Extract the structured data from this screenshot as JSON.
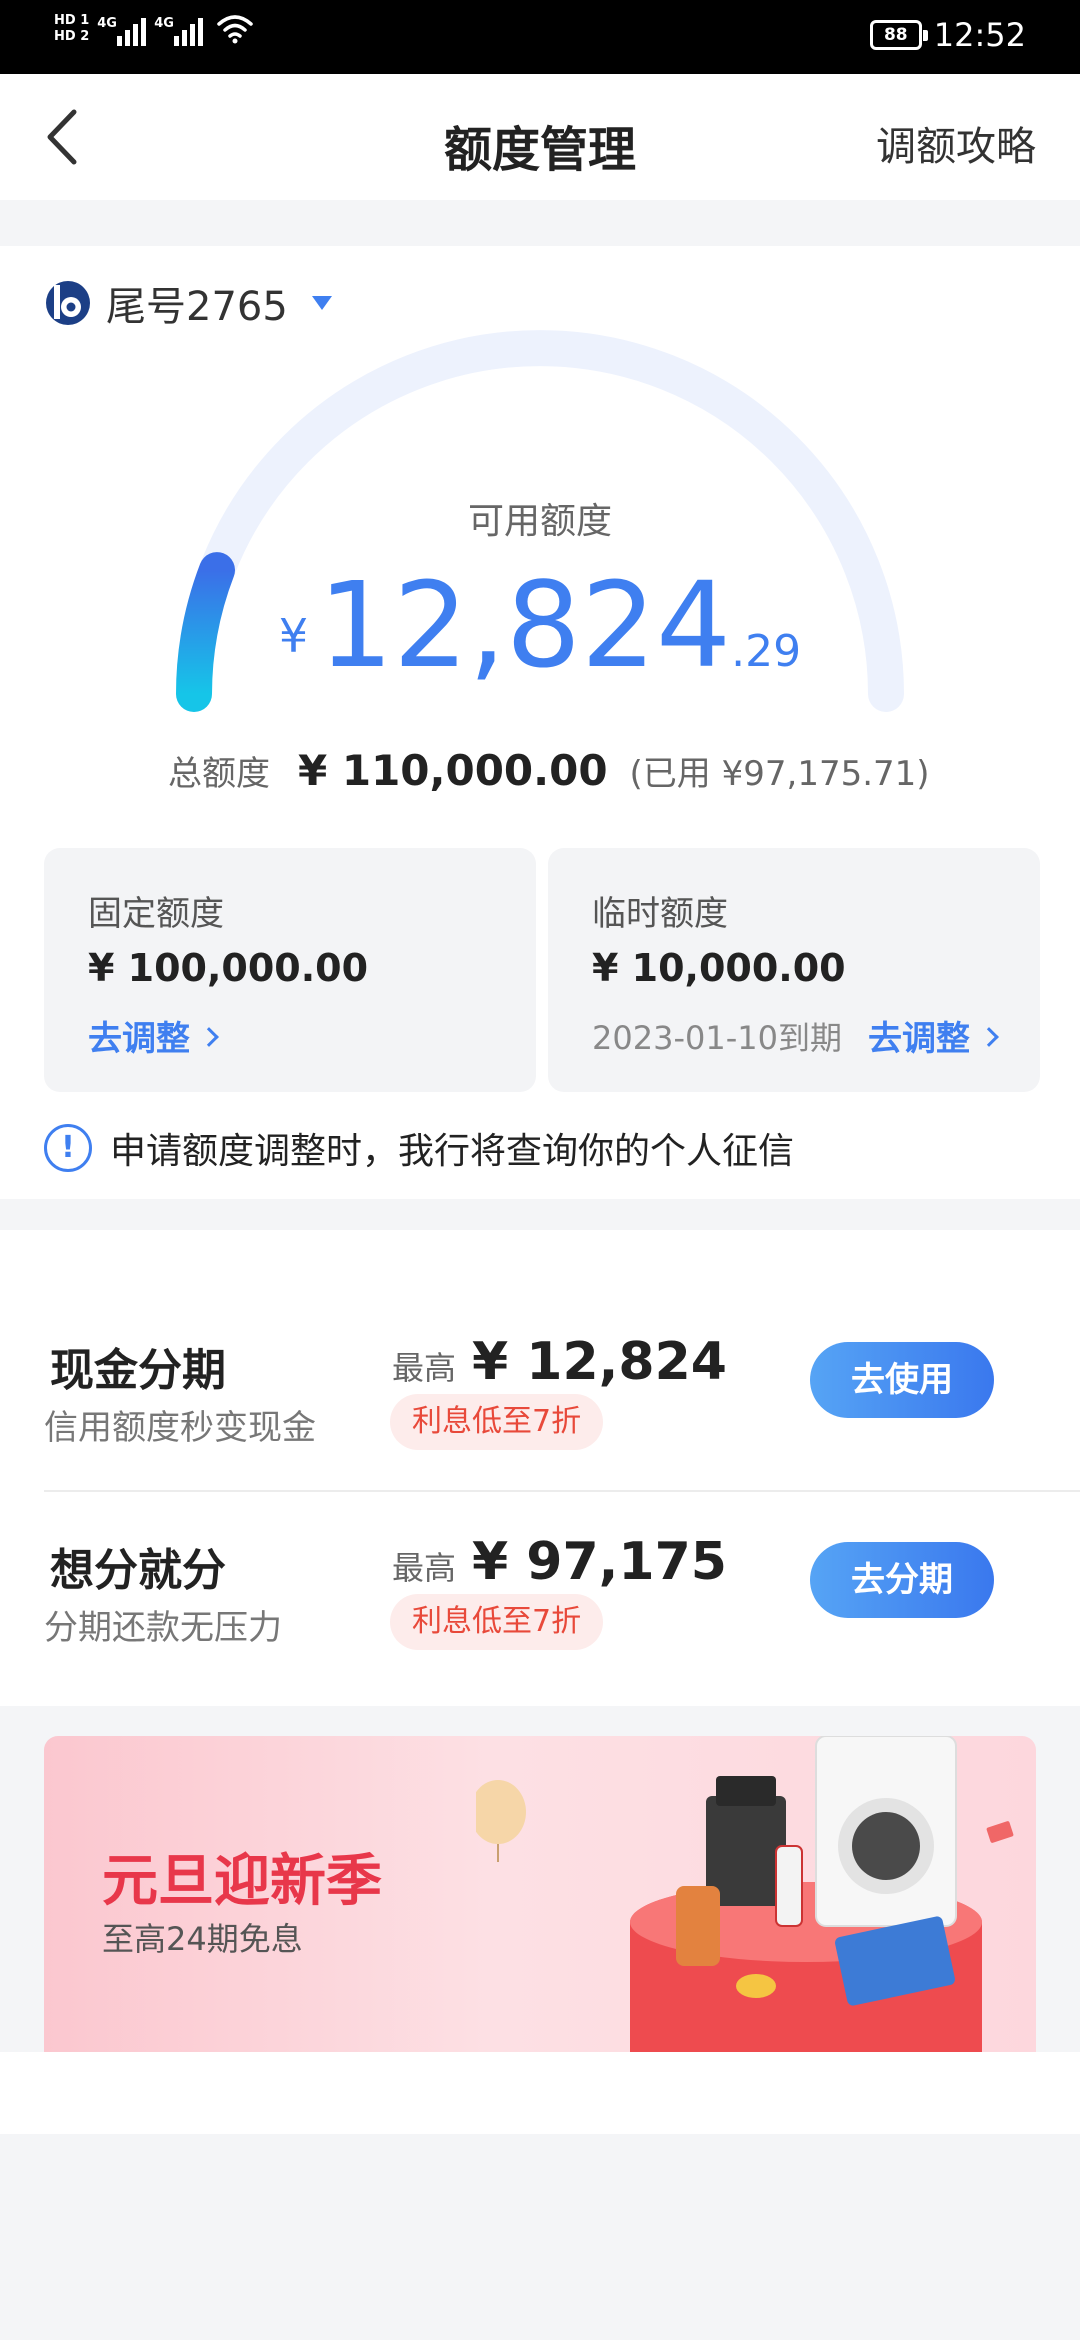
{
  "status_bar": {
    "hd1": "HD 1",
    "hd2": "HD 2",
    "net1": "4G",
    "net2": "4G",
    "battery": "88",
    "time": "12:52"
  },
  "nav": {
    "title": "额度管理",
    "right_link": "调额攻略"
  },
  "account": {
    "label": "尾号2765"
  },
  "credit": {
    "available_label": "可用额度",
    "currency": "¥",
    "available_int": "12,824",
    "available_dec": ".29",
    "total_label": "总额度",
    "total_amount": "¥ 110,000.00",
    "used_text": "(已用 ¥97,175.71)",
    "gauge_available_fraction": 0.1166,
    "colors": {
      "accent": "#3f7ff0",
      "gauge_track": "#edf2fd",
      "gauge_start": "#16c5e8"
    }
  },
  "fixed_limit": {
    "title": "固定额度",
    "amount": "¥ 100,000.00",
    "action": "去调整"
  },
  "temp_limit": {
    "title": "临时额度",
    "amount": "¥ 10,000.00",
    "expiry": "2023-01-10到期",
    "action": "去调整"
  },
  "notice": {
    "icon": "!",
    "text": "申请额度调整时，我行将查询你的个人征信"
  },
  "installments": [
    {
      "name": "现金分期",
      "subtitle": "信用额度秒变现金",
      "max_label": "最高",
      "max_amount": "¥ 12,824",
      "badge": "利息低至7折",
      "button": "去使用"
    },
    {
      "name": "想分就分",
      "subtitle": "分期还款无压力",
      "max_label": "最高",
      "max_amount": "¥ 97,175",
      "badge": "利息低至7折",
      "button": "去分期"
    }
  ],
  "banner": {
    "title": "元旦迎新季",
    "subtitle": "至高24期免息"
  }
}
